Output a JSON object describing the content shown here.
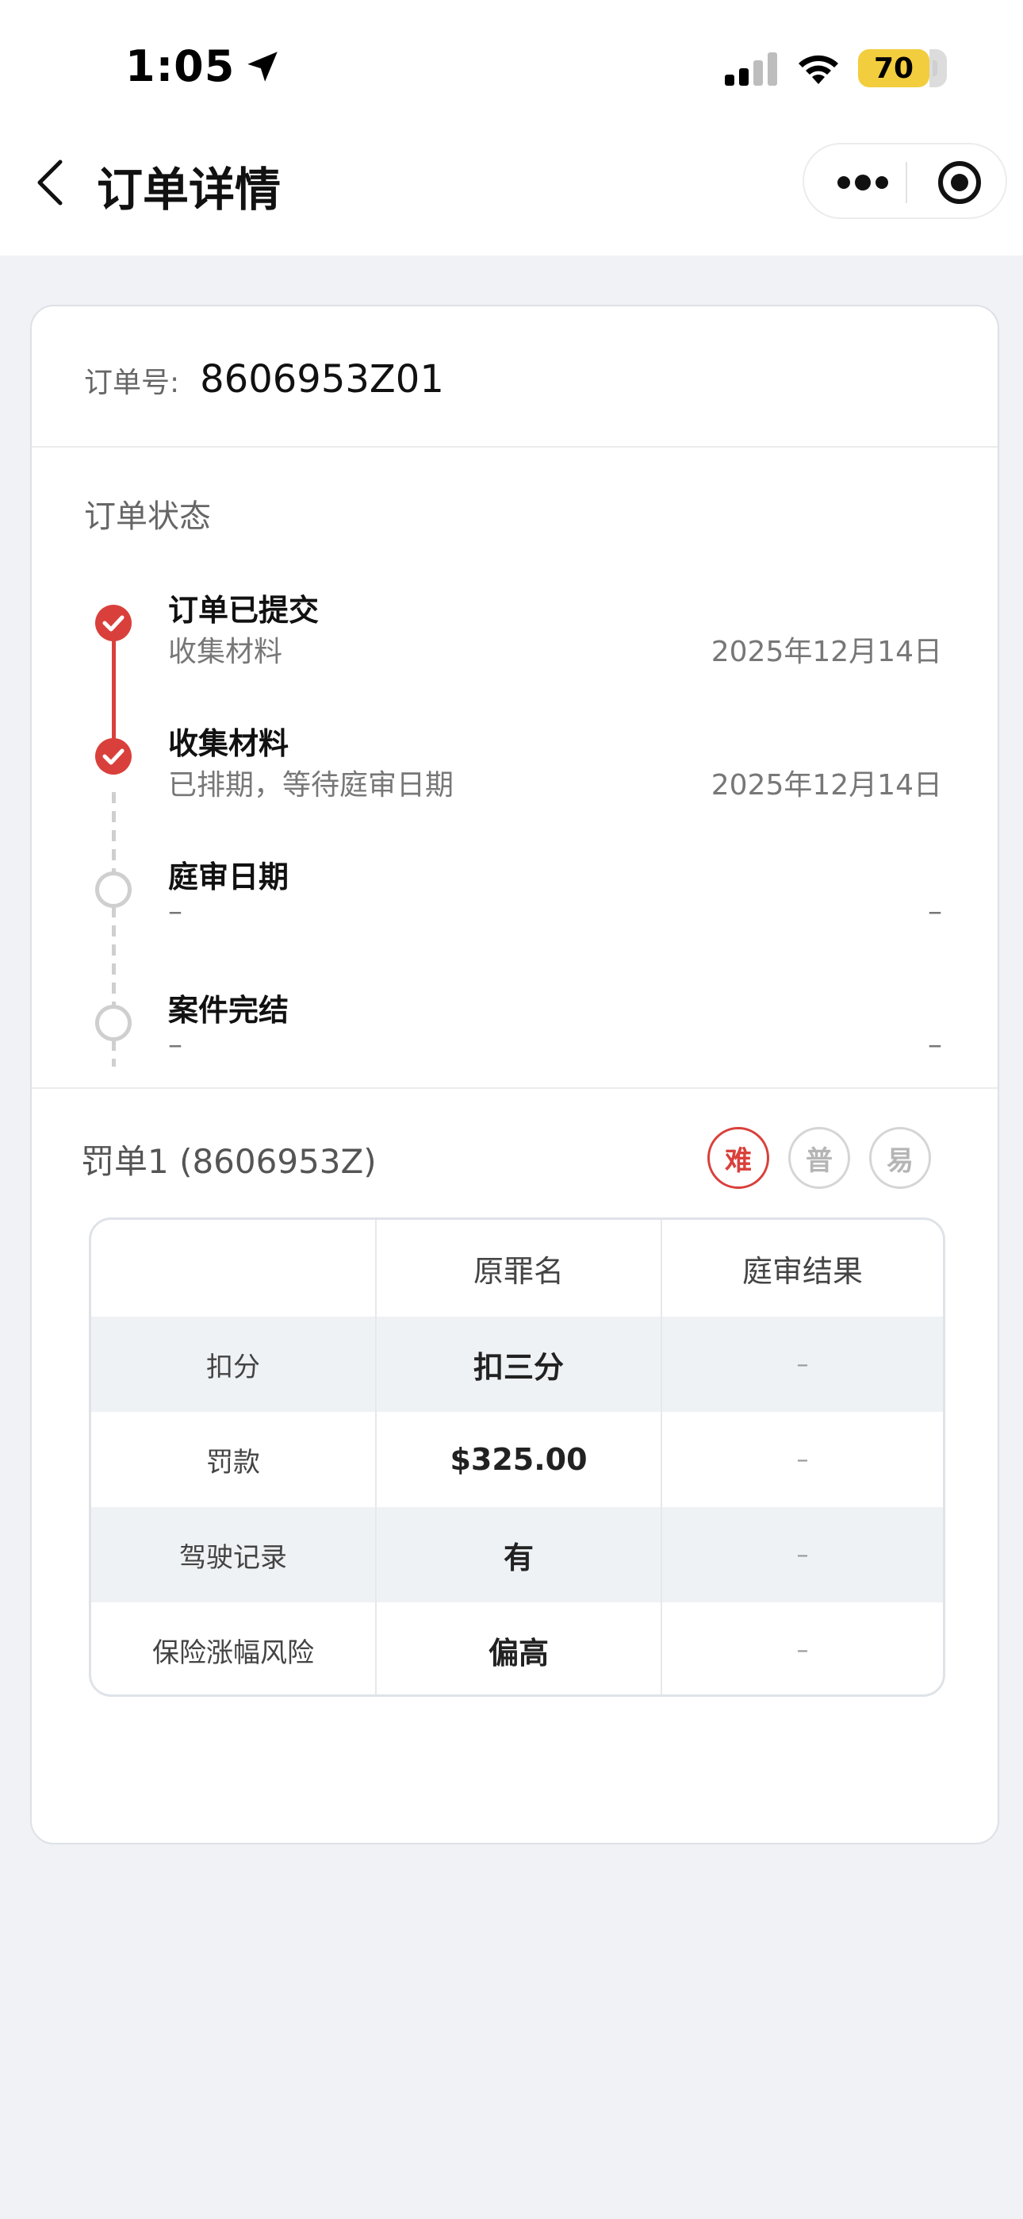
{
  "status_bar": {
    "time": "1:05",
    "battery": "70"
  },
  "nav": {
    "title": "订单详情"
  },
  "order": {
    "label": "订单号:",
    "number": "8606953Z01"
  },
  "status": {
    "title": "订单状态",
    "steps": [
      {
        "title": "订单已提交",
        "sub": "收集材料",
        "date": "2025年12月14日",
        "done": true
      },
      {
        "title": "收集材料",
        "sub": "已排期，等待庭审日期",
        "date": "2025年12月14日",
        "done": true
      },
      {
        "title": "庭审日期",
        "sub": "–",
        "date": "–",
        "done": false
      },
      {
        "title": "案件完结",
        "sub": "–",
        "date": "–",
        "done": false
      }
    ]
  },
  "ticket": {
    "title": "罚单1 (8606953Z)",
    "difficulty": [
      "难",
      "普",
      "易"
    ],
    "difficulty_selected": "难",
    "columns": [
      "",
      "原罪名",
      "庭审结果"
    ],
    "rows": [
      {
        "label": "扣分",
        "original": "扣三分",
        "result": "–"
      },
      {
        "label": "罚款",
        "original": "$325.00",
        "result": "–"
      },
      {
        "label": "驾驶记录",
        "original": "有",
        "result": "–"
      },
      {
        "label": "保险涨幅风险",
        "original": "偏高",
        "result": "–"
      }
    ]
  },
  "colors": {
    "accent": "#d9403b",
    "page_bg": "#f0f2f5",
    "battery": "#f2cd3e"
  },
  "icons": [
    "location-arrow-icon",
    "signal-icon",
    "wifi-icon",
    "back-icon",
    "more-icon",
    "target-icon",
    "check-icon"
  ]
}
